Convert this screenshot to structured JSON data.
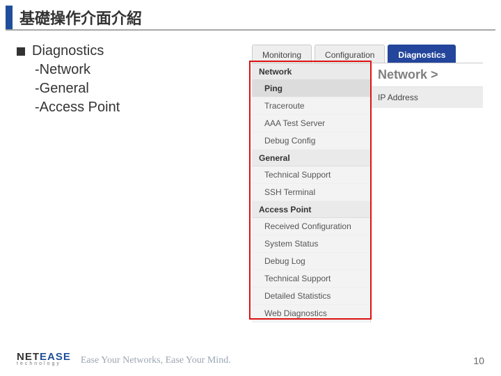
{
  "title": "基礎操作介面介紹",
  "left": {
    "heading": "Diagnostics",
    "subs": [
      "-Network",
      "-General",
      "-Access Point"
    ]
  },
  "tabs": [
    {
      "label": "Monitoring",
      "active": false
    },
    {
      "label": "Configuration",
      "active": false
    },
    {
      "label": "Diagnostics",
      "active": true
    }
  ],
  "sidebar": {
    "groups": [
      {
        "title": "Network",
        "items": [
          {
            "label": "Ping",
            "selected": true
          },
          {
            "label": "Traceroute"
          },
          {
            "label": "AAA Test Server"
          },
          {
            "label": "Debug Config"
          }
        ]
      },
      {
        "title": "General",
        "items": [
          {
            "label": "Technical Support"
          },
          {
            "label": "SSH Terminal"
          }
        ]
      },
      {
        "title": "Access Point",
        "items": [
          {
            "label": "Received Configuration"
          },
          {
            "label": "System Status"
          },
          {
            "label": "Debug Log"
          },
          {
            "label": "Technical Support"
          },
          {
            "label": "Detailed Statistics"
          },
          {
            "label": "Web Diagnostics"
          }
        ]
      }
    ]
  },
  "content": {
    "breadcrumb": "Network >",
    "field_label": "IP Address"
  },
  "footer": {
    "brand_a": "NET",
    "brand_b": "EASE",
    "brand_sub": "technology",
    "tagline": "Ease Your Networks, Ease Your Mind.",
    "page": "10"
  }
}
